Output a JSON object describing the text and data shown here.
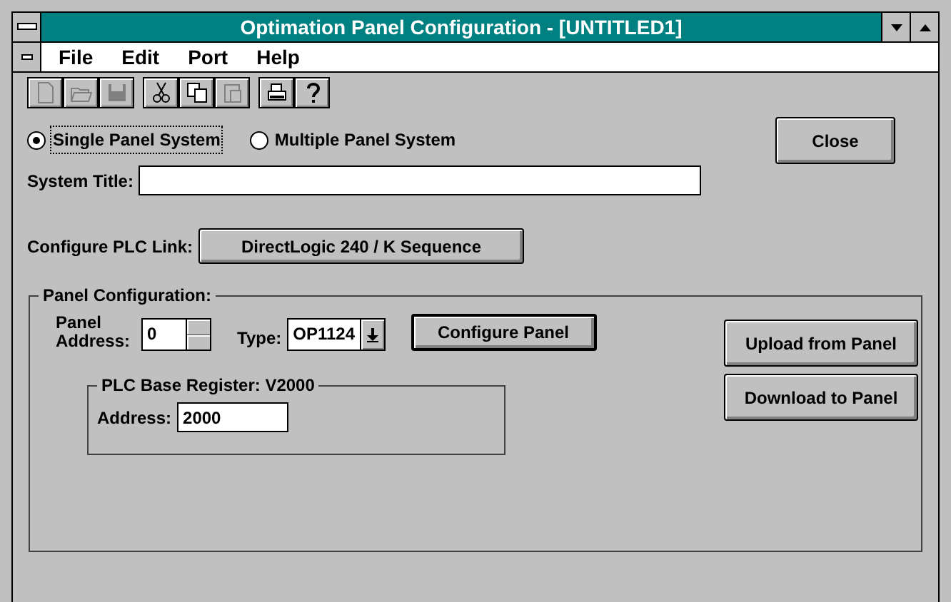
{
  "window": {
    "title": "Optimation Panel Configuration - [UNTITLED1]"
  },
  "menu": [
    {
      "label": "File"
    },
    {
      "label": "Edit"
    },
    {
      "label": "Port"
    },
    {
      "label": "Help"
    }
  ],
  "toolbar": [
    {
      "kind": "new",
      "disabled": true
    },
    {
      "kind": "open",
      "disabled": true
    },
    {
      "kind": "save",
      "disabled": true
    },
    {
      "kind": "cut",
      "disabled": false
    },
    {
      "kind": "copy",
      "disabled": false
    },
    {
      "kind": "paste",
      "disabled": true
    },
    {
      "kind": "print",
      "disabled": false
    },
    {
      "kind": "help",
      "disabled": false
    }
  ],
  "system_type": [
    {
      "label": "Single Panel System",
      "selected": true
    },
    {
      "label": "Multiple Panel System",
      "selected": false
    }
  ],
  "close_button": "Close",
  "system_title": {
    "label": "System Title:"
  },
  "plc_link": {
    "label": "Configure PLC Link:",
    "button": "DirectLogic 240 / K Sequence"
  },
  "panel_configuration": {
    "title": "Panel Configuration:",
    "address_label": "Panel Address:",
    "address_value": "0",
    "type_label": "Type:",
    "type_value": "OP1124",
    "configure_button": "Configure Panel",
    "plc_base": {
      "title": "PLC Base Register: V2000",
      "address_label": "Address:",
      "address_value": "2000"
    }
  },
  "transfer_buttons": [
    "Upload from Panel",
    "Download to Panel"
  ]
}
